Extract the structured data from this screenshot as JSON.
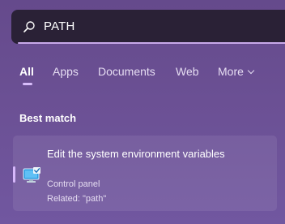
{
  "search": {
    "query": "PATH"
  },
  "tabs": [
    {
      "label": "All"
    },
    {
      "label": "Apps"
    },
    {
      "label": "Documents"
    },
    {
      "label": "Web"
    },
    {
      "label": "More"
    }
  ],
  "best_match": {
    "section_title": "Best match",
    "result": {
      "title": "Edit the system environment variables",
      "category": "Control panel",
      "related": "Related: \"path\""
    }
  },
  "colors": {
    "background": "#6b5094",
    "search_bar": "#2a2136",
    "accent": "#d6b7fb"
  },
  "icons": {
    "search": "search-icon",
    "result": "system-properties-icon",
    "more": "chevron-down-icon"
  }
}
